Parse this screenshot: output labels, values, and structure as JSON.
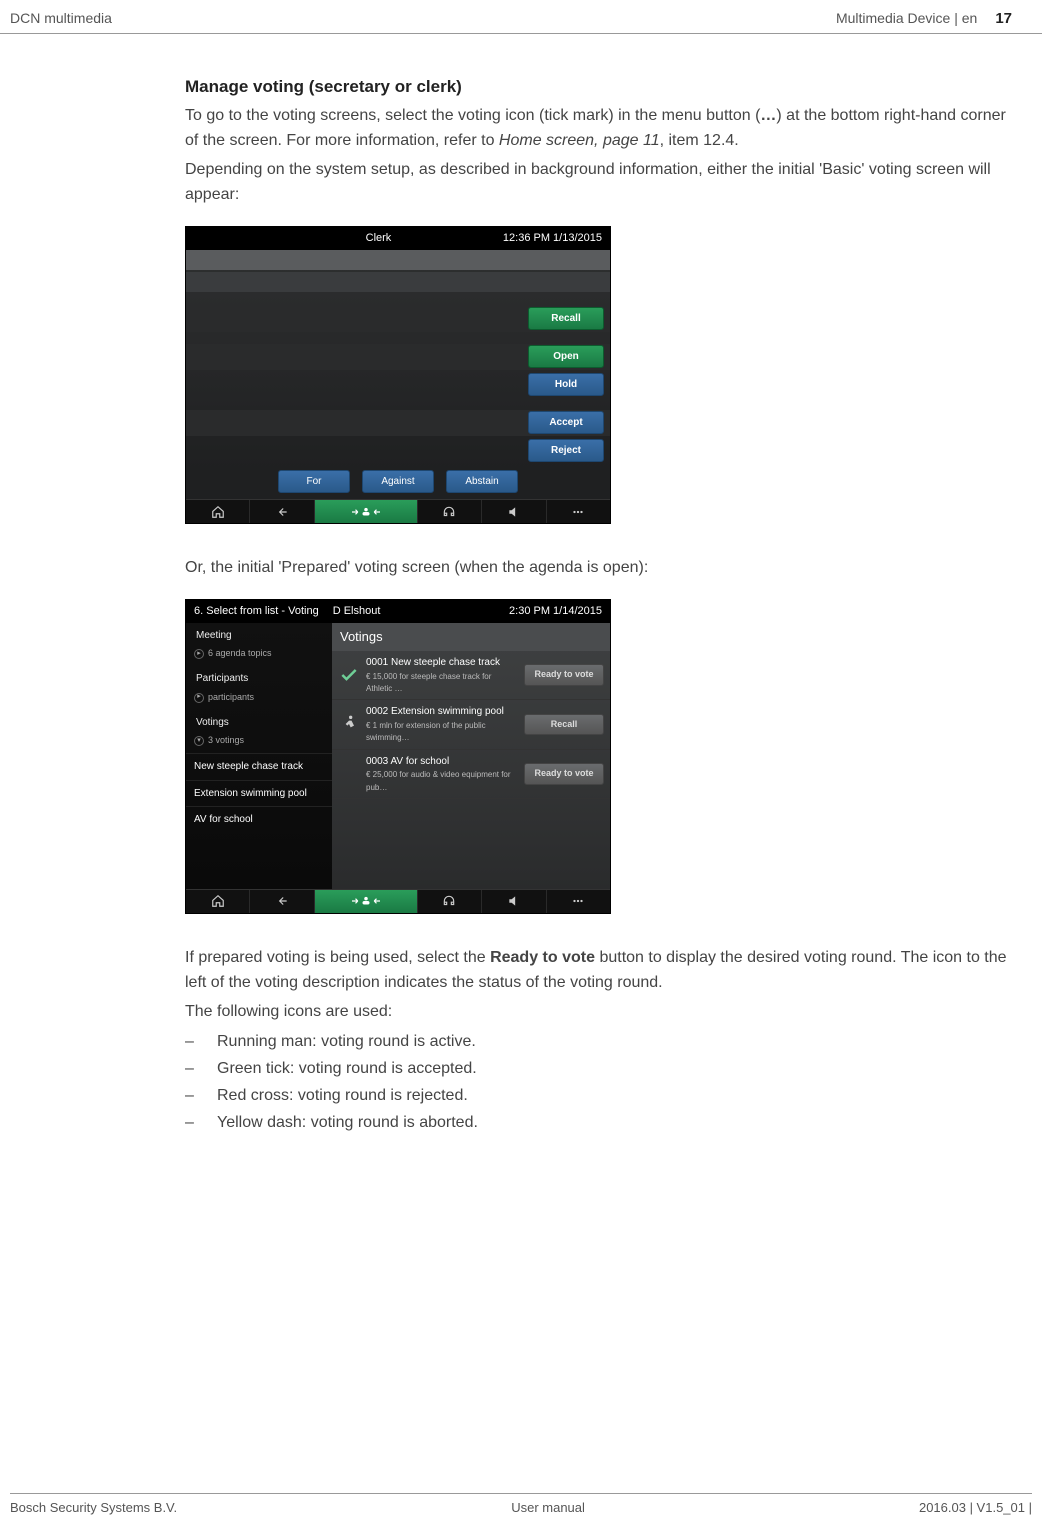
{
  "header": {
    "left": "DCN multimedia",
    "right_label": "Multimedia Device | en",
    "page_number": "17"
  },
  "section": {
    "title": "Manage voting (secretary or clerk)",
    "para1_a": "To go to the voting screens, select the voting icon (tick mark) in the menu button (",
    "para1_bold": "…",
    "para1_b": ") at the bottom right-hand corner of the screen. For more information, refer to ",
    "para1_ref": "Home screen, page 11",
    "para1_c": ", item 12.4.",
    "para2": "Depending on the system setup, as described in background information, either the initial 'Basic' voting screen will appear:",
    "para3": "Or, the initial 'Prepared' voting screen (when the agenda is open):",
    "para4_a": "If prepared voting is being used, select the ",
    "para4_bold": "Ready to vote",
    "para4_b": " button to display the desired voting round. The icon to the left of the voting description indicates the status of the voting round.",
    "para5": "The following icons are used:",
    "bullets": [
      "Running man: voting round is active.",
      "Green tick: voting round is accepted.",
      "Red cross: voting round is rejected.",
      "Yellow dash: voting round is aborted."
    ]
  },
  "screenshot1": {
    "title_center": "Clerk",
    "title_right": "12:36 PM 1/13/2015",
    "btn_recall": "Recall",
    "btn_open": "Open",
    "btn_hold": "Hold",
    "btn_accept": "Accept",
    "btn_reject": "Reject",
    "btn_for": "For",
    "btn_against": "Against",
    "btn_abstain": "Abstain"
  },
  "screenshot2": {
    "title_left": "6. Select from list - Voting",
    "title_center": "D Elshout",
    "title_right": "2:30 PM 1/14/2015",
    "side": {
      "meeting": "Meeting",
      "meeting_sub": "6 agenda topics",
      "participants": "Participants",
      "participants_sub": "participants",
      "votings": "Votings",
      "votings_sub": "3 votings",
      "leaf1": "New steeple chase track",
      "leaf2": "Extension swimming pool",
      "leaf3": "AV for school"
    },
    "panel_title": "Votings",
    "items": [
      {
        "title": "0001  New steeple chase track",
        "sub": "€ 15,000 for steeple chase track for Athletic …",
        "btn": "Ready to vote"
      },
      {
        "title": "0002  Extension swimming pool",
        "sub": "€ 1 mln for extension of the public swimming…",
        "btn": "Recall"
      },
      {
        "title": "0003  AV for school",
        "sub": "€ 25,000 for audio & video equipment for pub…",
        "btn": "Ready to vote"
      }
    ]
  },
  "footer": {
    "left": "Bosch Security Systems B.V.",
    "center": "User manual",
    "right": "2016.03 | V1.5_01 |"
  }
}
